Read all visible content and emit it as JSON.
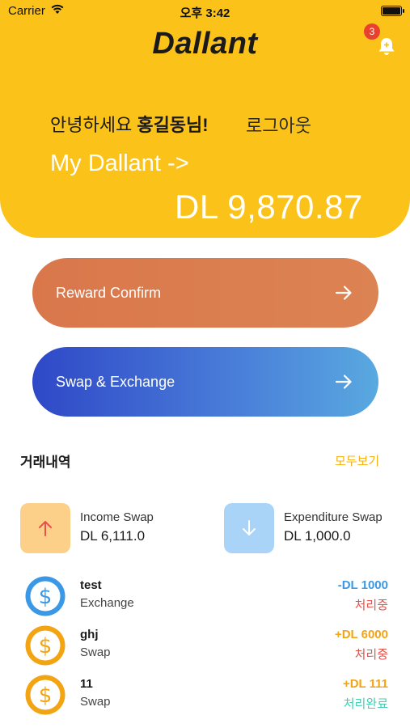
{
  "status_bar": {
    "carrier": "Carrier",
    "time": "오후 3:42"
  },
  "header": {
    "logo": "Dallant",
    "notification_count": "3",
    "greeting": "안녕하세요",
    "user_name": "홍길동님!",
    "logout": "로그아웃",
    "my_dallant": "My Dallant ->",
    "balance": "DL 9,870.87"
  },
  "actions": {
    "reward_confirm": "Reward Confirm",
    "swap_exchange": "Swap & Exchange"
  },
  "history": {
    "title": "거래내역",
    "see_all": "모두보기",
    "summary": {
      "income_label": "Income Swap",
      "income_value": "DL 6,111.0",
      "expenditure_label": "Expenditure Swap",
      "expenditure_value": "DL 1,000.0"
    },
    "transactions": [
      {
        "name": "test",
        "type": "Exchange",
        "amount": "-DL 1000",
        "status": "처리중",
        "icon_color": "#3a98e6",
        "amount_color": "#3a98e6",
        "status_color": "#e8504a"
      },
      {
        "name": "ghj",
        "type": "Swap",
        "amount": "+DL 6000",
        "status": "처리중",
        "icon_color": "#f3a412",
        "amount_color": "#f3a412",
        "status_color": "#e8504a"
      },
      {
        "name": "11",
        "type": "Swap",
        "amount": "+DL 111",
        "status": "처리완료",
        "icon_color": "#f3a412",
        "amount_color": "#f3a412",
        "status_color": "#3fcfb0"
      }
    ]
  },
  "colors": {
    "brand_yellow": "#fbc31a",
    "reward": "#d9774b",
    "swap_start": "#2f48c7",
    "swap_end": "#59a9e0"
  }
}
